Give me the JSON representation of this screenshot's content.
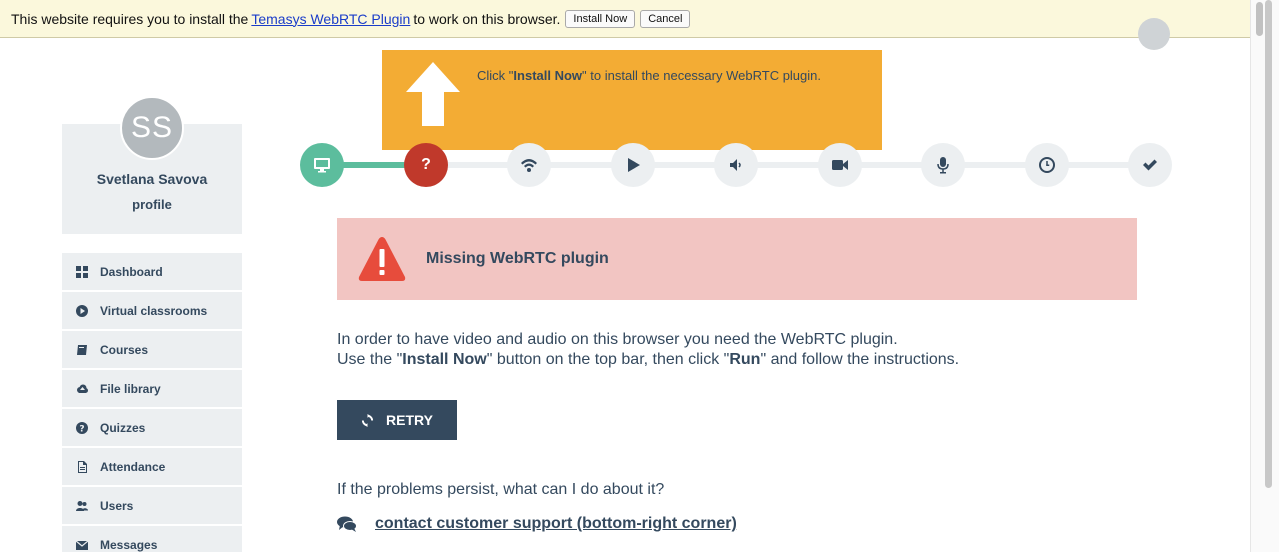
{
  "plugin_bar": {
    "text_before": "This website requires you to install the",
    "link": "Temasys WebRTC Plugin",
    "text_after": "to work on this browser.",
    "install_label": "Install Now",
    "cancel_label": "Cancel"
  },
  "tooltip": {
    "before": "Click \"",
    "bold": "Install Now",
    "after": "\" to install the necessary WebRTC plugin."
  },
  "profile": {
    "initials": "SS",
    "name": "Svetlana Savova",
    "link": "profile"
  },
  "sidebar": {
    "items": [
      {
        "label": "Dashboard",
        "icon": "dashboard-icon"
      },
      {
        "label": "Virtual classrooms",
        "icon": "play-circle-icon"
      },
      {
        "label": "Courses",
        "icon": "book-icon"
      },
      {
        "label": "File library",
        "icon": "cloud-upload-icon"
      },
      {
        "label": "Quizzes",
        "icon": "question-circle-icon"
      },
      {
        "label": "Attendance",
        "icon": "document-icon"
      },
      {
        "label": "Users",
        "icon": "users-icon"
      },
      {
        "label": "Messages",
        "icon": "envelope-icon"
      }
    ]
  },
  "steps": [
    {
      "icon": "desktop-icon",
      "state": "done"
    },
    {
      "icon": "question-icon",
      "state": "error",
      "glyph": "?"
    },
    {
      "icon": "wifi-icon",
      "state": "pending"
    },
    {
      "icon": "play-icon",
      "state": "pending"
    },
    {
      "icon": "volume-icon",
      "state": "pending"
    },
    {
      "icon": "video-camera-icon",
      "state": "pending"
    },
    {
      "icon": "microphone-icon",
      "state": "pending"
    },
    {
      "icon": "clock-icon",
      "state": "pending"
    },
    {
      "icon": "check-icon",
      "state": "pending"
    }
  ],
  "alert": {
    "title": "Missing WebRTC plugin",
    "color": "#f2c5c2"
  },
  "description": {
    "line1": "In order to have video and audio on this browser you need the WebRTC plugin.",
    "line2_a": "Use the \"",
    "line2_b": "Install Now",
    "line2_c": "\" button on the top bar, then click \"",
    "line2_d": "Run",
    "line2_e": "\" and follow the instructions."
  },
  "retry_label": "RETRY",
  "persist_text": "If the problems persist, what can I do about it?",
  "support_link": "contact customer support (bottom-right corner)",
  "colors": {
    "accent": "#34495e",
    "success": "#5cbd9d",
    "error": "#c0392b",
    "warning": "#f3ac34"
  }
}
